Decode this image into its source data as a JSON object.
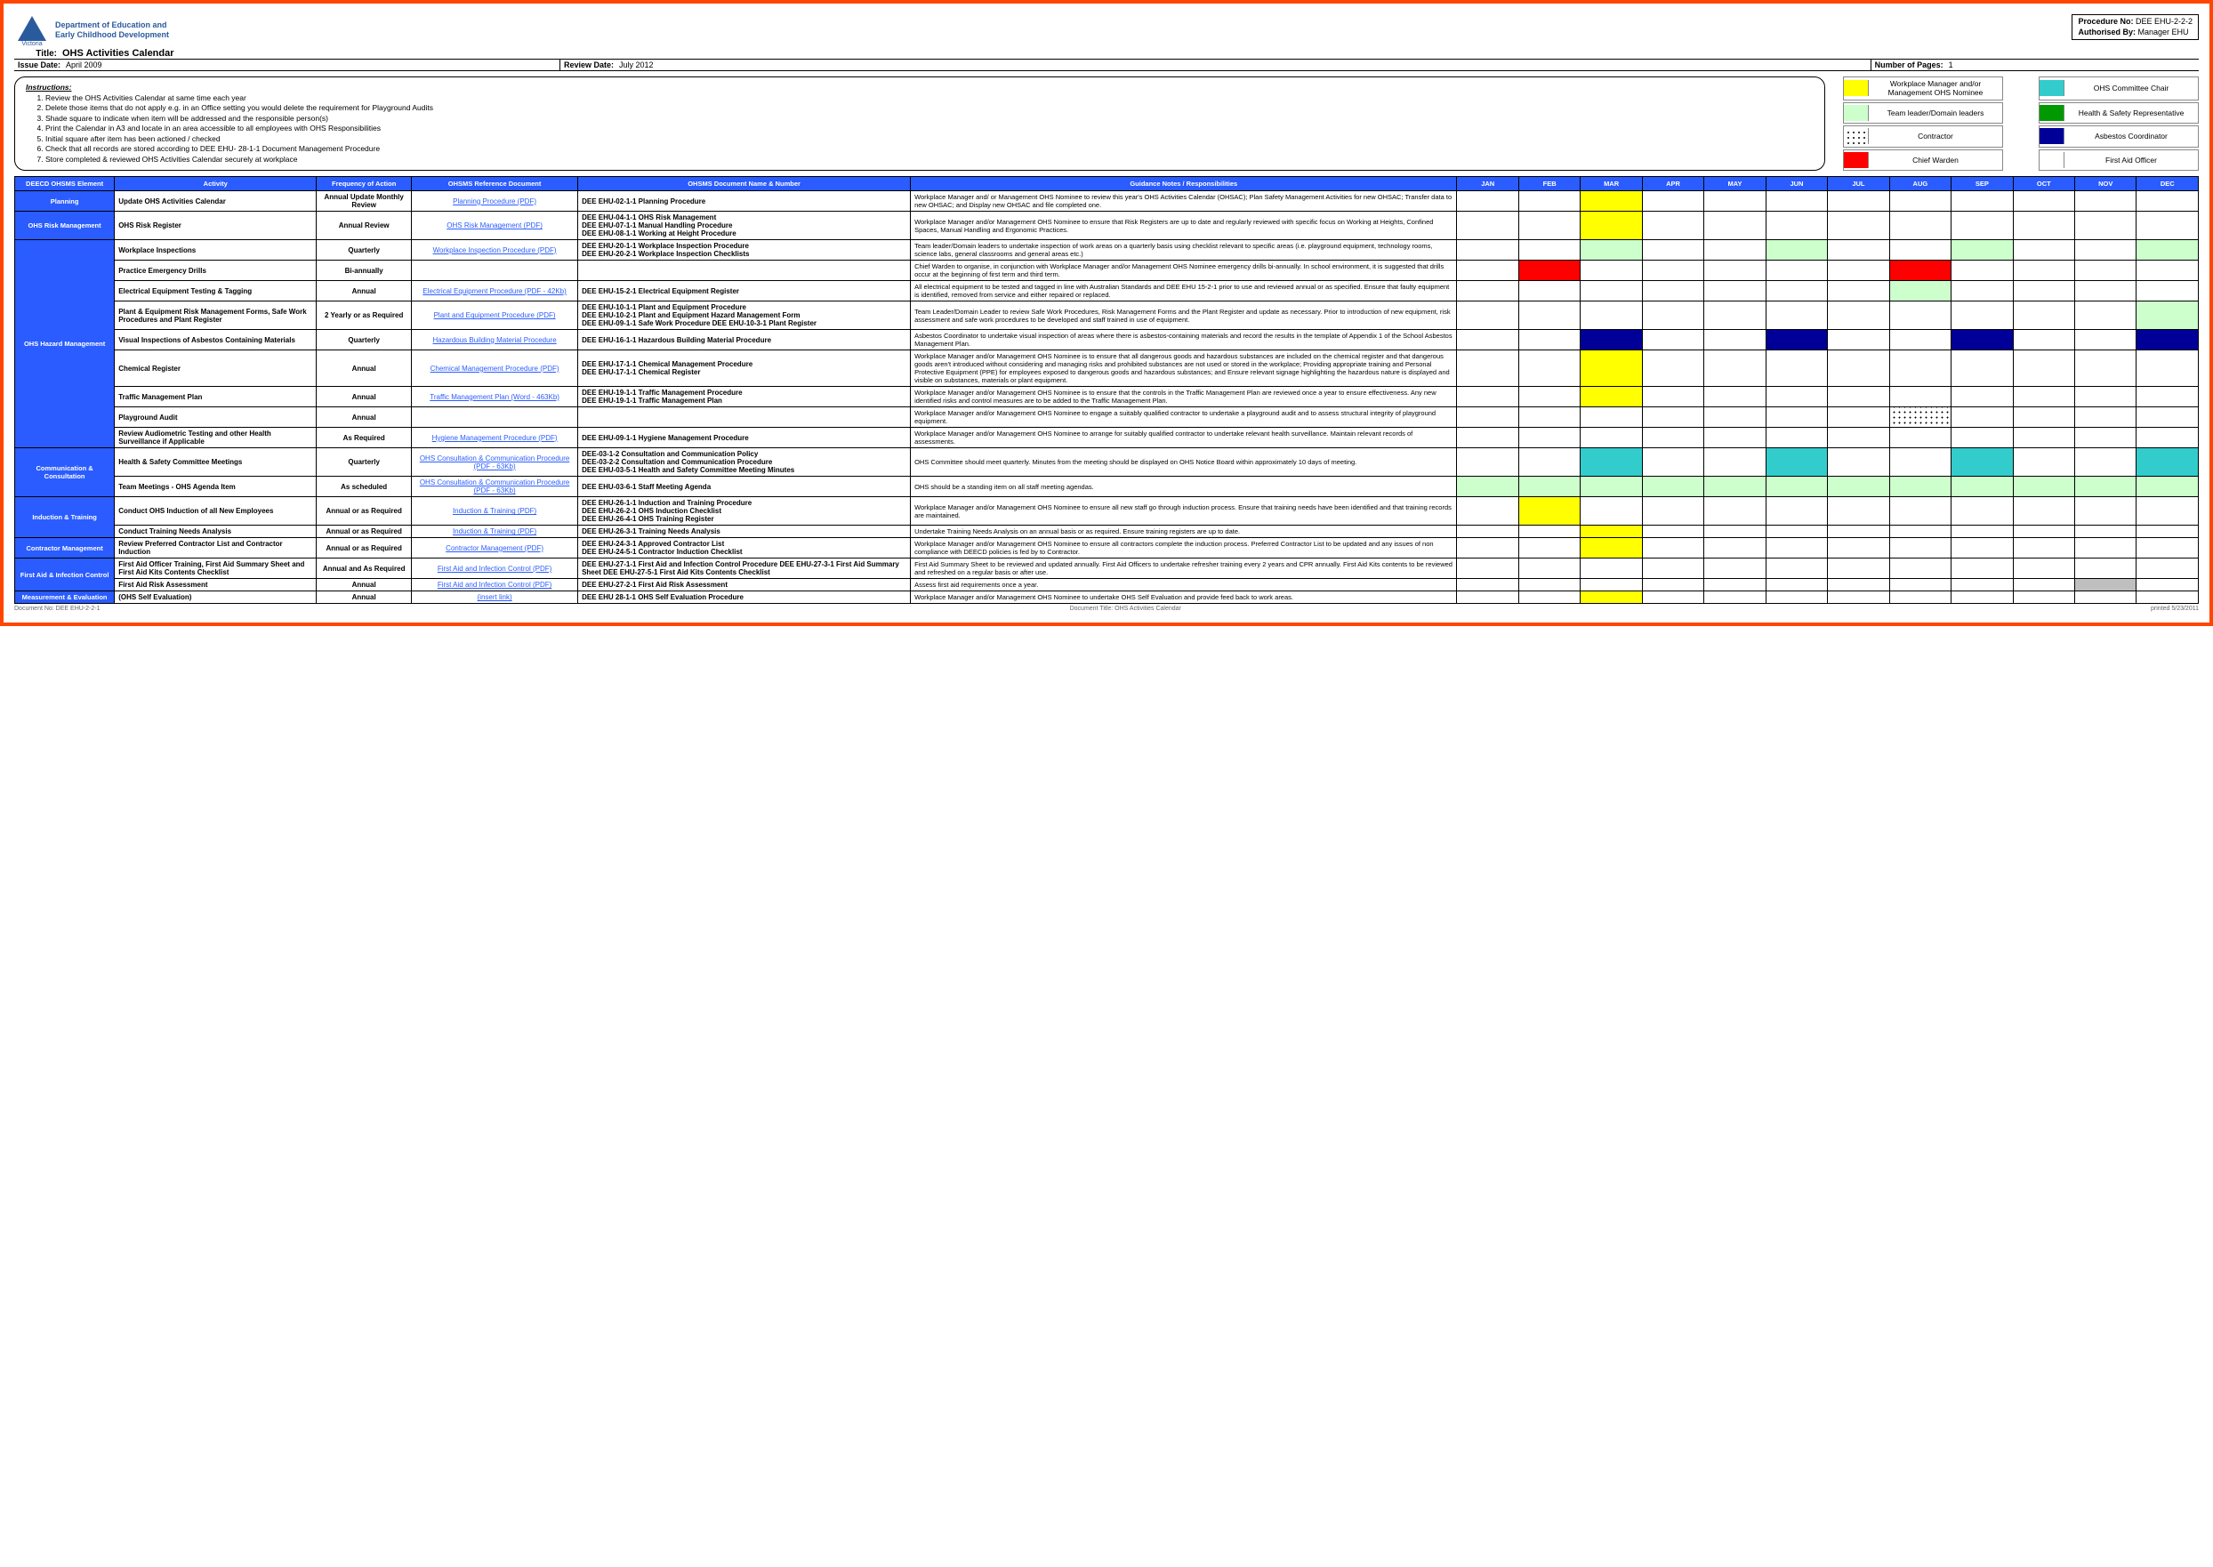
{
  "header": {
    "dept_line1": "Department of Education and",
    "dept_line2": "Early Childhood Development",
    "procedure_no_lbl": "Procedure No:",
    "procedure_no": "DEE EHU-2-2-2",
    "authorised_lbl": "Authorised By:",
    "authorised": "Manager EHU",
    "title_lbl": "Title:",
    "title": "OHS Activities Calendar",
    "issue_date_lbl": "Issue Date:",
    "issue_date": "April 2009",
    "review_date_lbl": "Review Date:",
    "review_date": "July 2012",
    "pages_lbl": "Number of Pages:",
    "pages": "1"
  },
  "instructions": {
    "label": "Instructions:",
    "items": [
      "Review the OHS Activities Calendar at same time each year",
      "Delete those items that do not apply e.g. in an Office setting you would delete the requirement for Playground Audits",
      "Shade square to indicate when item will be addressed and the responsible person(s)",
      "Print the Calendar in A3 and locate in an area accessible to all employees with OHS Responsibilities",
      "Initial square after item has been actioned / checked",
      "Check that all records are stored according to DEE EHU- 28-1-1 Document Management Procedure",
      "Store completed & reviewed OHS Activities Calendar securely at workplace"
    ]
  },
  "legend": [
    {
      "cls": "c-yellow",
      "lbl": "Workplace Manager and/or Management OHS Nominee"
    },
    {
      "cls": "c-cyan",
      "lbl": "OHS Committee Chair"
    },
    {
      "cls": "c-ltgreen",
      "lbl": "Team leader/Domain leaders"
    },
    {
      "cls": "c-green",
      "lbl": "Health & Safety Representative"
    },
    {
      "cls": "c-dots",
      "lbl": "Contractor"
    },
    {
      "cls": "c-navy",
      "lbl": "Asbestos Coordinator"
    },
    {
      "cls": "c-red",
      "lbl": "Chief Warden"
    },
    {
      "cls": "c-white",
      "lbl": "First Aid Officer"
    }
  ],
  "columns": {
    "element": "DEECD OHSMS Element",
    "activity": "Activity",
    "freq": "Frequency of Action",
    "refdoc": "OHSMS Reference Document",
    "docnum": "OHSMS Document Name & Number",
    "guidance": "Guidance Notes / Responsibilities"
  },
  "months": [
    "JAN",
    "FEB",
    "MAR",
    "APR",
    "MAY",
    "JUN",
    "JUL",
    "AUG",
    "SEP",
    "OCT",
    "NOV",
    "DEC"
  ],
  "groups": [
    {
      "name": "Planning",
      "rows": [
        {
          "activity": "Update OHS Activities Calendar",
          "freq": "Annual Update Monthly Review",
          "ref": "Planning Procedure (PDF)",
          "doc": "DEE EHU-02-1-1 Planning Procedure",
          "guide": "Workplace Manager and/ or Management OHS Nominee to review this year's OHS Activities Calendar (OHSAC); Plan Safety Management Activities for new OHSAC; Transfer data to new OHSAC; and Display new OHSAC and file completed one.",
          "cells": [
            "",
            "",
            "c-yellow",
            "",
            "",
            "",
            "",
            "",
            "",
            "",
            "",
            ""
          ]
        }
      ]
    },
    {
      "name": "OHS Risk Management",
      "rows": [
        {
          "activity": "OHS Risk Register",
          "freq": "Annual Review",
          "ref": "OHS Risk Management (PDF)",
          "doc": "DEE EHU-04-1-1 OHS Risk Management\nDEE EHU-07-1-1 Manual Handling Procedure\nDEE EHU-08-1-1 Working at Height Procedure",
          "guide": "Workplace Manager and/or Management OHS Nominee to ensure that Risk Registers are up to date and regularly reviewed with specific focus on Working at Heights, Confined Spaces, Manual Handling and Ergonomic Practices.",
          "cells": [
            "",
            "",
            "c-yellow",
            "",
            "",
            "",
            "",
            "",
            "",
            "",
            "",
            ""
          ]
        }
      ]
    },
    {
      "name": "OHS Hazard Management",
      "rows": [
        {
          "activity": "Workplace Inspections",
          "freq": "Quarterly",
          "ref": "Workplace Inspection Procedure (PDF)",
          "doc": "DEE EHU-20-1-1 Workplace Inspection Procedure\nDEE EHU-20-2-1 Workplace Inspection Checklists",
          "guide": "Team leader/Domain leaders to undertake inspection of work areas on a quarterly basis using checklist relevant to specific areas (i.e. playground equipment, technology rooms, science labs, general classrooms and general areas etc.)",
          "cells": [
            "",
            "",
            "c-ltgreen",
            "",
            "",
            "c-ltgreen",
            "",
            "",
            "c-ltgreen",
            "",
            "",
            "c-ltgreen"
          ]
        },
        {
          "activity": "Practice Emergency Drills",
          "freq": "Bi-annually",
          "ref": "",
          "doc": "",
          "guide": "Chief Warden to organise, in conjunction with Workplace Manager and/or Management OHS Nominee emergency drills bi-annually. In school environment, it is suggested that drills occur at the beginning of first term and third term.",
          "cells": [
            "",
            "c-red",
            "",
            "",
            "",
            "",
            "",
            "c-red",
            "",
            "",
            "",
            ""
          ]
        },
        {
          "activity": "Electrical Equipment Testing & Tagging",
          "freq": "Annual",
          "ref": "Electrical Equipment Procedure (PDF - 42Kb)",
          "doc": "DEE EHU-15-2-1 Electrical Equipment Register",
          "guide": "All electrical equipment to be tested and tagged in line with Australian Standards and DEE EHU 15-2-1 prior to use and reviewed annual or as specified. Ensure that faulty equipment is identified, removed from service and either repaired or replaced.",
          "cells": [
            "",
            "",
            "",
            "",
            "",
            "",
            "",
            "c-ltgreen",
            "",
            "",
            "",
            ""
          ]
        },
        {
          "activity": "Plant & Equipment Risk Management Forms, Safe Work Procedures and Plant Register",
          "freq": "2 Yearly or as Required",
          "ref": "Plant and Equipment Procedure (PDF)",
          "doc": "DEE EHU-10-1-1 Plant and Equipment Procedure\nDEE EHU-10-2-1 Plant and Equipment Hazard Management Form\nDEE EHU-09-1-1 Safe Work Procedure     DEE EHU-10-3-1 Plant Register",
          "guide": "Team Leader/Domain Leader to review Safe Work Procedures, Risk Management Forms and the Plant Register and update as necessary. Prior to introduction of new equipment, risk assessment and safe work procedures to be developed and staff trained in use of equipment.",
          "cells": [
            "",
            "",
            "",
            "",
            "",
            "",
            "",
            "",
            "",
            "",
            "",
            "c-ltgreen"
          ]
        },
        {
          "activity": "Visual Inspections of Asbestos Containing Materials",
          "freq": "Quarterly",
          "ref": "Hazardous Building Material Procedure",
          "doc": "DEE EHU-16-1-1 Hazardous Building Material Procedure",
          "guide": "Asbestos Coordinator to undertake visual inspection of areas where there is asbestos-containing materials and record the results in the template of Appendix 1 of the School Asbestos Management Plan.",
          "cells": [
            "",
            "",
            "c-navy",
            "",
            "",
            "c-navy",
            "",
            "",
            "c-navy",
            "",
            "",
            "c-navy"
          ]
        },
        {
          "activity": "Chemical Register",
          "freq": "Annual",
          "ref": "Chemical Management Procedure (PDF)",
          "doc": "DEE EHU-17-1-1 Chemical Management Procedure\nDEE EHU-17-1-1 Chemical Register",
          "guide": "Workplace Manager and/or Management OHS Nominee is to ensure that all dangerous goods and hazardous substances are included on the chemical register and that dangerous goods aren't introduced without considering and managing risks and prohibited substances are not used or stored in the workplace; Providing appropriate training and Personal Protective Equipment (PPE) for employees exposed to dangerous goods and hazardous substances; and Ensure relevant signage highlighting the hazardous nature is displayed and visible on substances, materials or plant equipment.",
          "cells": [
            "",
            "",
            "c-yellow",
            "",
            "",
            "",
            "",
            "",
            "",
            "",
            "",
            ""
          ]
        },
        {
          "activity": "Traffic Management Plan",
          "freq": "Annual",
          "ref": "Traffic Management Plan (Word - 463Kb)",
          "doc": "DEE EHU-19-1-1 Traffic Management Procedure\nDEE EHU-19-1-1 Traffic Management Plan",
          "guide": "Workplace Manager and/or Management OHS Nominee is to ensure that the controls in the Traffic Management Plan are reviewed once a year to ensure effectiveness. Any new identified risks and control measures are to be added to the Traffic Management Plan.",
          "cells": [
            "",
            "",
            "c-yellow",
            "",
            "",
            "",
            "",
            "",
            "",
            "",
            "",
            ""
          ]
        },
        {
          "activity": "Playground Audit",
          "freq": "Annual",
          "ref": "",
          "doc": "",
          "guide": "Workplace Manager and/or Management OHS Nominee to engage a suitably qualified contractor to undertake a playground audit and to assess structural integrity of playground equipment.",
          "cells": [
            "",
            "",
            "",
            "",
            "",
            "",
            "",
            "c-dots",
            "",
            "",
            "",
            ""
          ]
        },
        {
          "activity": "Review Audiometric Testing and other Health Surveillance if Applicable",
          "freq": "As Required",
          "ref": "Hygiene Management Procedure (PDF)",
          "doc": "DEE EHU-09-1-1 Hygiene Management Procedure",
          "guide": "Workplace Manager and/or Management OHS Nominee to arrange for suitably qualified contractor to undertake relevant health surveillance. Maintain relevant records of assessments.",
          "cells": [
            "",
            "",
            "",
            "",
            "",
            "",
            "",
            "",
            "",
            "",
            "",
            ""
          ]
        }
      ]
    },
    {
      "name": "Communication & Consultation",
      "rows": [
        {
          "activity": "Health & Safety Committee Meetings",
          "freq": "Quarterly",
          "ref": "OHS Consultation & Communication Procedure (PDF - 63Kb)",
          "doc": "DEE-03-1-2 Consultation and Communication Policy\nDEE-03-2-2 Consultation and Communication Procedure\nDEE EHU-03-5-1 Health and Safety Committee Meeting Minutes",
          "guide": "OHS Committee should meet quarterly. Minutes from the meeting should be displayed on OHS Notice Board within approximately 10 days of meeting.",
          "cells": [
            "",
            "",
            "c-cyan",
            "",
            "",
            "c-cyan",
            "",
            "",
            "c-cyan",
            "",
            "",
            "c-cyan"
          ]
        },
        {
          "activity": "Team Meetings - OHS Agenda Item",
          "freq": "As scheduled",
          "ref": "OHS Consultation & Communication Procedure (PDF - 63Kb)",
          "doc": "DEE EHU-03-6-1 Staff Meeting Agenda",
          "guide": "OHS should be a standing item on all staff meeting agendas.",
          "cells": [
            "c-ltgreen",
            "c-ltgreen",
            "c-ltgreen",
            "c-ltgreen",
            "c-ltgreen",
            "c-ltgreen",
            "c-ltgreen",
            "c-ltgreen",
            "c-ltgreen",
            "c-ltgreen",
            "c-ltgreen",
            "c-ltgreen"
          ]
        }
      ]
    },
    {
      "name": "Induction & Training",
      "rows": [
        {
          "activity": "Conduct OHS Induction of all New Employees",
          "freq": "Annual or as Required",
          "ref": "Induction & Training (PDF)",
          "doc": "DEE EHU-26-1-1 Induction and Training Procedure\nDEE EHU-26-2-1 OHS Induction Checklist\nDEE EHU-26-4-1 OHS Training Register",
          "guide": "Workplace Manager and/or Management OHS Nominee to ensure all new staff go through induction process. Ensure that training needs have been identified and that training records are maintained.",
          "cells": [
            "",
            "c-yellow",
            "",
            "",
            "",
            "",
            "",
            "",
            "",
            "",
            "",
            ""
          ]
        },
        {
          "activity": "Conduct Training Needs Analysis",
          "freq": "Annual or as Required",
          "ref": "Induction & Training (PDF)",
          "doc": "DEE EHU-26-3-1 Training Needs Analysis",
          "guide": "Undertake Training Needs Analysis on an annual basis or as required. Ensure training registers are up to date.",
          "cells": [
            "",
            "",
            "c-yellow",
            "",
            "",
            "",
            "",
            "",
            "",
            "",
            "",
            ""
          ]
        }
      ]
    },
    {
      "name": "Contractor Management",
      "rows": [
        {
          "activity": "Review Preferred Contractor List and Contractor Induction",
          "freq": "Annual or as Required",
          "ref": "Contractor Management (PDF)",
          "doc": "DEE EHU-24-3-1 Approved Contractor List\nDEE EHU-24-5-1 Contractor Induction Checklist",
          "guide": "Workplace Manager and/or Management OHS Nominee to ensure all contractors complete the induction process. Preferred Contractor List to be updated and any issues of non compliance with DEECD policies is fed by to Contractor.",
          "cells": [
            "",
            "",
            "c-yellow",
            "",
            "",
            "",
            "",
            "",
            "",
            "",
            "",
            ""
          ]
        }
      ]
    },
    {
      "name": "First Aid & Infection Control",
      "rows": [
        {
          "activity": "First Aid Officer Training, First Aid Summary Sheet and First Aid Kits Contents Checklist",
          "freq": "Annual and As Required",
          "ref": "First Aid and Infection Control (PDF)",
          "doc": "DEE EHU-27-1-1 First Aid and Infection Control Procedure   DEE EHU-27-3-1 First Aid Summary Sheet   DEE EHU-27-5-1 First Aid Kits Contents Checklist",
          "guide": "First Aid Summary Sheet to be reviewed and updated annually. First Aid Officers to undertake refresher training every 2 years and CPR annually. First Aid Kits contents to be reviewed and refreshed on a regular basis or after use.",
          "cells": [
            "",
            "",
            "",
            "",
            "",
            "",
            "",
            "",
            "",
            "",
            "",
            ""
          ]
        },
        {
          "activity": "First Aid Risk Assessment",
          "freq": "Annual",
          "ref": "First Aid and Infection Control (PDF)",
          "doc": "DEE EHU-27-2-1 First Aid Risk Assessment",
          "guide": "Assess first aid requirements once a year.",
          "cells": [
            "",
            "",
            "",
            "",
            "",
            "",
            "",
            "",
            "",
            "",
            "c-grey",
            ""
          ]
        }
      ]
    },
    {
      "name": "Measurement & Evaluation",
      "rows": [
        {
          "activity": "(OHS Self Evaluation)",
          "freq": "Annual",
          "ref": "(insert link)",
          "doc": "DEE EHU 28-1-1 OHS Self Evaluation Procedure",
          "guide": "Workplace Manager and/or Management OHS Nominee to undertake OHS Self Evaluation and provide feed back to work areas.",
          "cells": [
            "",
            "",
            "c-yellow",
            "",
            "",
            "",
            "",
            "",
            "",
            "",
            "",
            ""
          ]
        }
      ]
    }
  ],
  "footer": {
    "left": "Document No: DEE EHU-2-2-1",
    "center": "Document Title: OHS Activities Calendar",
    "right": "printed 5/23/2011"
  }
}
